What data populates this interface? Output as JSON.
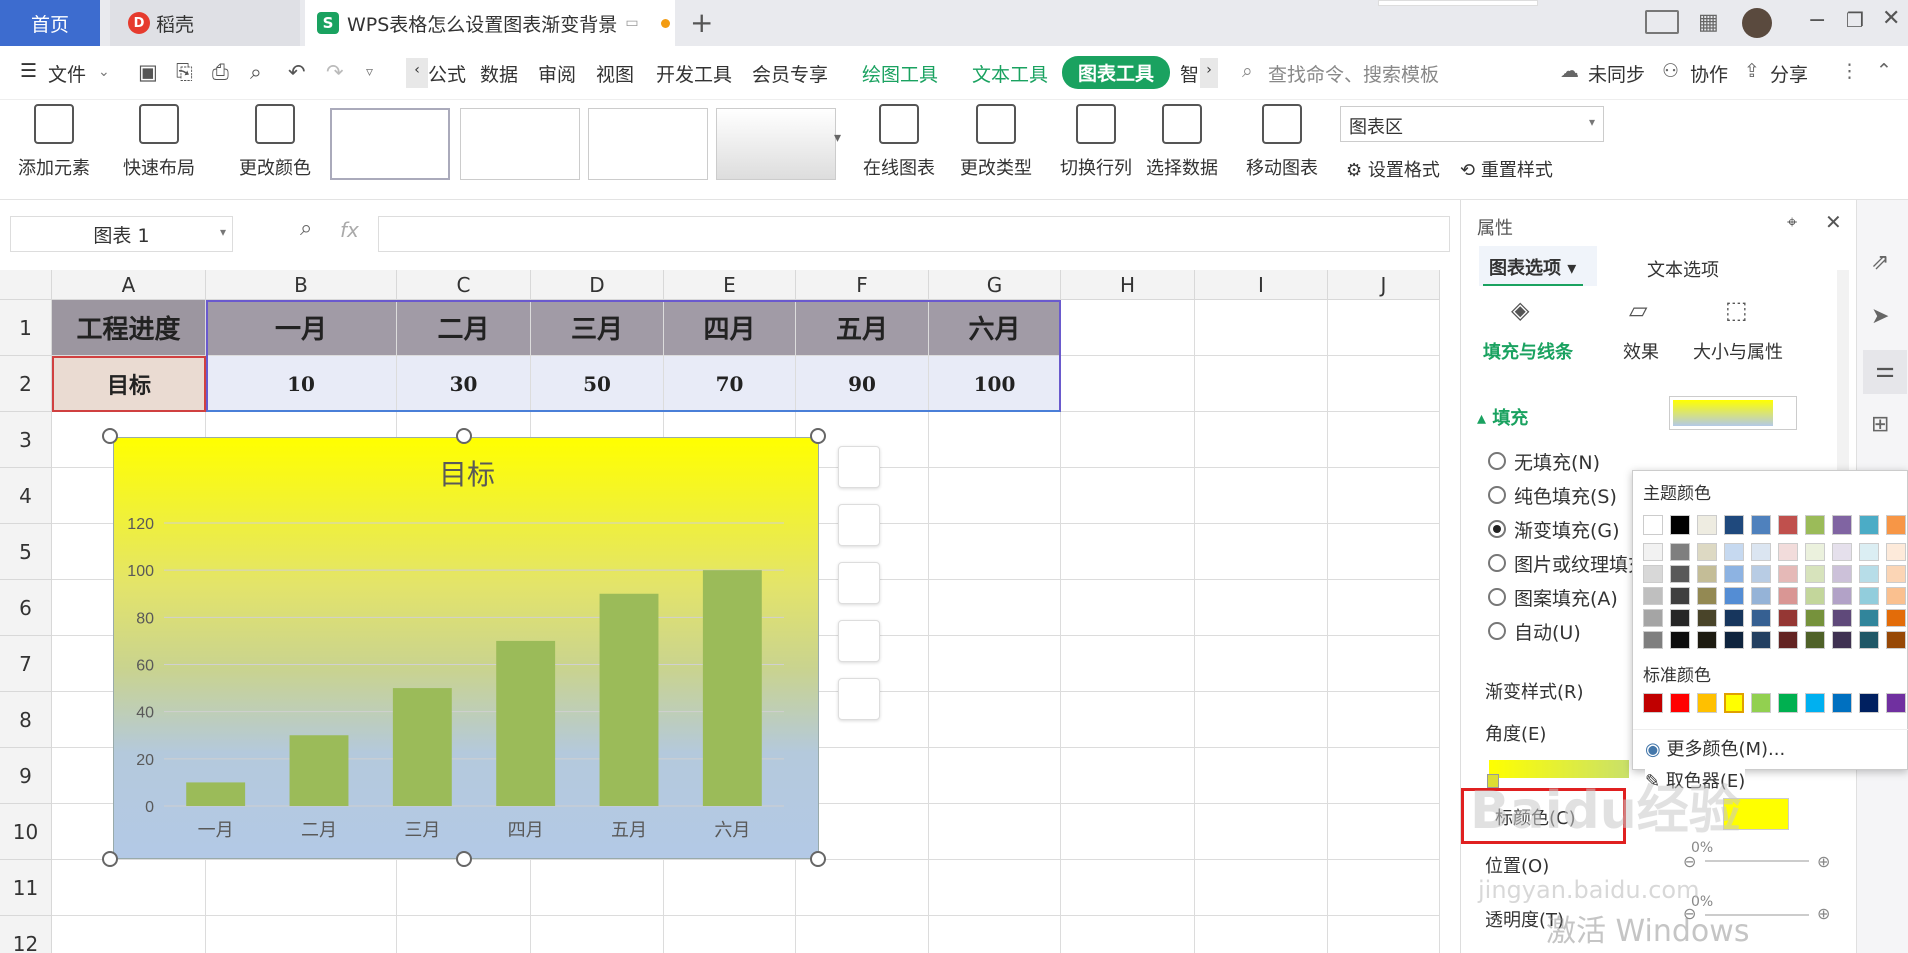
{
  "titlebar": {
    "home": "首页",
    "daoke": "稻壳",
    "doc_title": "WPS表格怎么设置图表渐变背景",
    "add_icon": "plus-icon"
  },
  "menu": {
    "file": "文件",
    "items": [
      "公式",
      "数据",
      "审阅",
      "视图",
      "开发工具",
      "会员专享"
    ],
    "draw_tools": "绘图工具",
    "text_tools": "文本工具",
    "chart_tools": "图表工具",
    "more": "智",
    "search_placeholder": "查找命令、搜索模板",
    "sync": "未同步",
    "collab": "协作",
    "share": "分享"
  },
  "ribbon": {
    "add_element": "添加元素",
    "quick_layout": "快速布局",
    "change_color": "更改颜色",
    "online_chart": "在线图表",
    "change_type": "更改类型",
    "switch_rowcol": "切换行列",
    "select_data": "选择数据",
    "move_chart": "移动图表",
    "area_select": "图表区",
    "set_format": "设置格式",
    "reset_style": "重置样式"
  },
  "formula": {
    "namebox": "图表 1",
    "fx": "fx"
  },
  "sheet": {
    "columns": [
      "A",
      "B",
      "C",
      "D",
      "E",
      "F",
      "G",
      "H",
      "I",
      "J"
    ],
    "rows": [
      "1",
      "2",
      "3",
      "4",
      "5",
      "6",
      "7",
      "8",
      "9",
      "10",
      "11",
      "12"
    ],
    "row1": [
      "工程进度",
      "一月",
      "二月",
      "三月",
      "四月",
      "五月",
      "六月"
    ],
    "row2": [
      "目标",
      "10",
      "30",
      "50",
      "70",
      "90",
      "100"
    ]
  },
  "chart_data": {
    "type": "bar",
    "title": "目标",
    "categories": [
      "一月",
      "二月",
      "三月",
      "四月",
      "五月",
      "六月"
    ],
    "values": [
      10,
      30,
      50,
      70,
      90,
      100
    ],
    "ylim": [
      0,
      120
    ],
    "yticks": [
      "0",
      "20",
      "40",
      "60",
      "80",
      "100",
      "120"
    ],
    "bar_color": "#9bbb59",
    "grid": true,
    "background": "gradient yellow to light blue"
  },
  "panel": {
    "header": "属性",
    "tab_chart": "图表选项",
    "tab_text": "文本选项",
    "sub_fill": "填充与线条",
    "sub_effect": "效果",
    "sub_size": "大小与属性",
    "fill": "填充",
    "options": [
      "无填充(N)",
      "纯色填充(S)",
      "渐变填充(G)",
      "图片或纹理填充",
      "图案填充(A)",
      "自动(U)"
    ],
    "selected": 2,
    "grad_style": "渐变样式(R)",
    "angle": "角度(E)",
    "stop_color": "标颜色(C)",
    "position": "位置(O)",
    "transparency": "透明度(T)",
    "pct1": "0%",
    "pct2": "0%"
  },
  "popup": {
    "theme": "主题颜色",
    "standard": "标准颜色",
    "more_colors": "更多颜色(M)...",
    "picker": "取色器(E)",
    "theme_top": [
      "#ffffff",
      "#000000",
      "#eeece1",
      "#1f497d",
      "#4f81bd",
      "#c0504d",
      "#9bbb59",
      "#8064a2",
      "#4bacc6",
      "#f79646"
    ],
    "standard_colors": [
      "#c00000",
      "#ff0000",
      "#ffc000",
      "#ffff00",
      "#92d050",
      "#00b050",
      "#00b0f0",
      "#0070c0",
      "#002060",
      "#7030a0"
    ]
  },
  "watermark": {
    "baidu": "Baidu经验",
    "url": "jingyan.baidu.com",
    "activate": "激活 Windows"
  }
}
